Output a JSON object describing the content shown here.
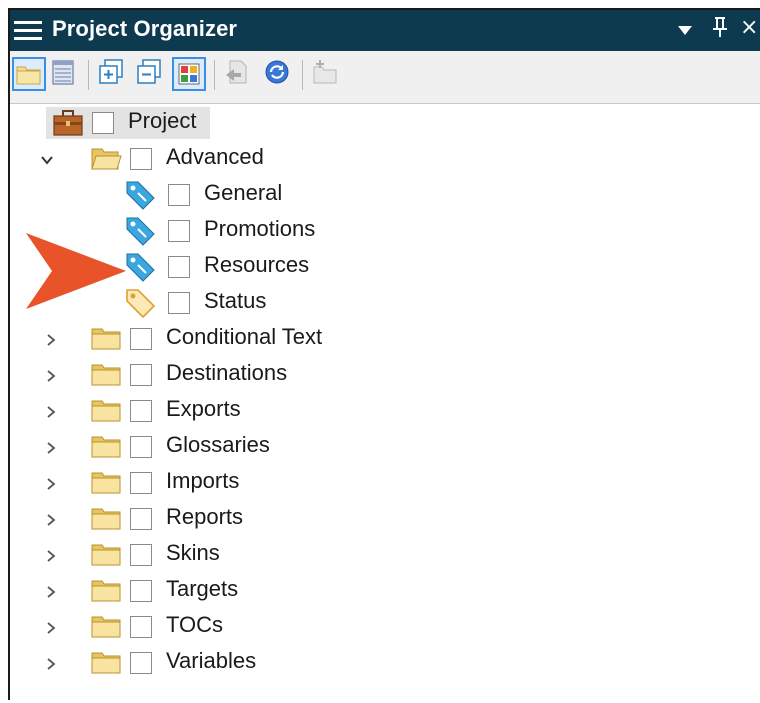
{
  "titlebar": {
    "title": "Project Organizer",
    "menu_icon": "hamburger-icon",
    "dropdown_icon": "dropdown-triangle-icon",
    "pin_icon": "pin-icon",
    "close_icon": "close-icon",
    "pin_glyph": "q",
    "close_glyph": "×",
    "color": "#0e3a4f"
  },
  "toolbar": {
    "buttons": [
      {
        "name": "open-folder-view-icon",
        "selected": true
      },
      {
        "name": "list-view-icon",
        "selected": false
      },
      {
        "name": "expand-all-icon",
        "selected": false
      },
      {
        "name": "collapse-all-icon",
        "selected": false
      },
      {
        "name": "color-grid-icon",
        "selected": true
      },
      {
        "name": "import-file-icon",
        "selected": false,
        "disabled": true
      },
      {
        "name": "refresh-icon",
        "selected": false
      },
      {
        "name": "new-folder-icon",
        "selected": false,
        "disabled": true
      }
    ]
  },
  "tree": {
    "root": {
      "label": "Project",
      "icon": "briefcase-icon",
      "selected": true
    },
    "expanded_folder": {
      "label": "Advanced",
      "icon": "open-folder-icon",
      "children": [
        {
          "label": "General",
          "icon": "blue-tag-icon"
        },
        {
          "label": "Promotions",
          "icon": "blue-tag-icon"
        },
        {
          "label": "Resources",
          "icon": "blue-tag-icon"
        },
        {
          "label": "Status",
          "icon": "orange-tag-icon"
        }
      ]
    },
    "folders": [
      {
        "label": "Conditional Text"
      },
      {
        "label": "Destinations"
      },
      {
        "label": "Exports"
      },
      {
        "label": "Glossaries"
      },
      {
        "label": "Imports"
      },
      {
        "label": "Reports"
      },
      {
        "label": "Skins"
      },
      {
        "label": "Targets"
      },
      {
        "label": "TOCs"
      },
      {
        "label": "Variables"
      }
    ]
  },
  "callout": {
    "icon": "red-arrow-callout-icon",
    "color": "#e8532a"
  },
  "colors": {
    "accent": "#3a8ee6",
    "folder": "#f5dc8a",
    "tag_blue": "#3ba7e0",
    "tag_orange": "#f0b040"
  }
}
